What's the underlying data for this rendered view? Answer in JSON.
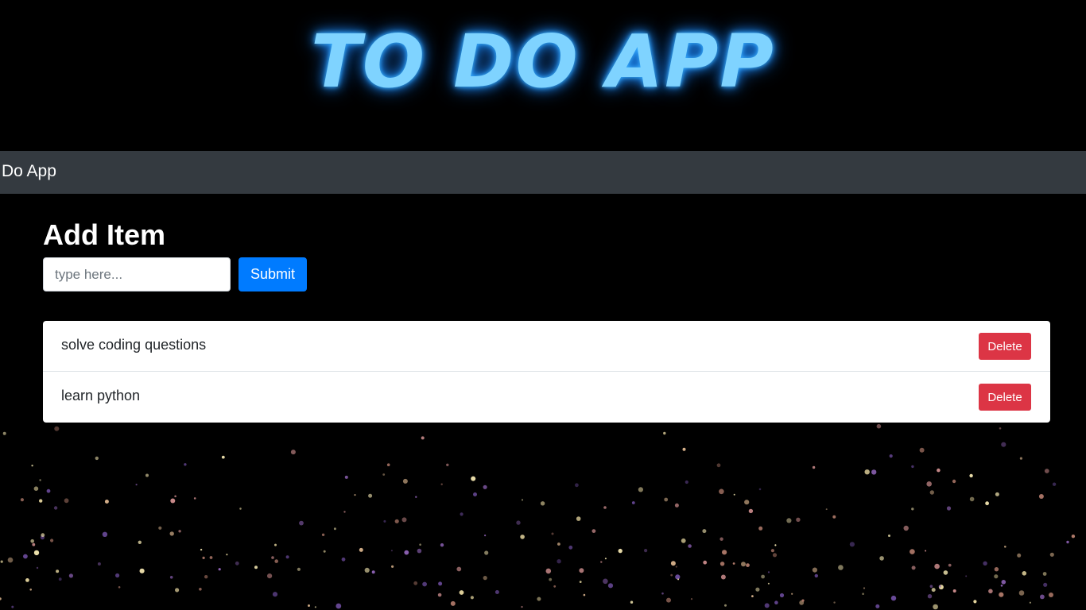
{
  "hero": {
    "title": "TO DO APP"
  },
  "navbar": {
    "brand": "To Do App"
  },
  "form": {
    "heading": "Add Item",
    "input_placeholder": "type here...",
    "input_value": "",
    "submit_label": "Submit"
  },
  "items": [
    {
      "text": "solve coding questions",
      "delete_label": "Delete"
    },
    {
      "text": "learn python",
      "delete_label": "Delete"
    }
  ],
  "colors": {
    "title_glow": "#7fd3ff",
    "navbar_bg": "#343a40",
    "primary": "#007bff",
    "danger": "#dc3545",
    "background": "#000000"
  }
}
